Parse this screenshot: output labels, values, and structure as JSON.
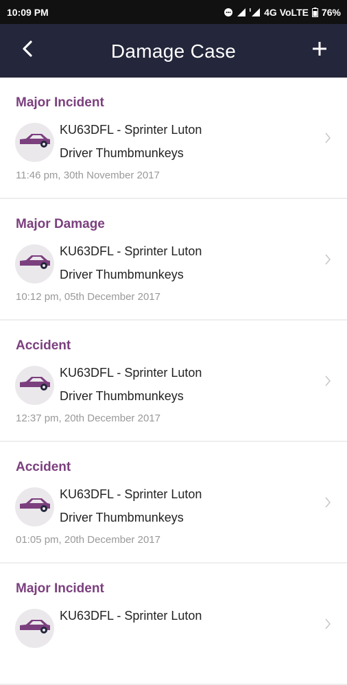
{
  "status_bar": {
    "time": "10:09 PM",
    "network": "4G VoLTE",
    "battery": "76%",
    "icons": [
      "chat-bubble-icon",
      "signal-icon",
      "signal-icon",
      "battery-icon"
    ]
  },
  "header": {
    "title": "Damage Case",
    "back_icon": "back-chevron-icon",
    "add_icon": "plus-icon",
    "background": "#24263b"
  },
  "colors": {
    "accent": "#7b3f7e",
    "car_icon": "#7b3f7e",
    "avatar_bg": "#ebe8ec",
    "timestamp": "#999999"
  },
  "cases": [
    {
      "type": "Major Incident",
      "vehicle": "KU63DFL - Sprinter Luton",
      "driver": "Driver Thumbmunkeys",
      "timestamp": "11:46 pm, 30th November 2017",
      "icon": "car-icon"
    },
    {
      "type": "Major Damage",
      "vehicle": "KU63DFL - Sprinter Luton",
      "driver": "Driver Thumbmunkeys",
      "timestamp": "10:12 pm, 05th December 2017",
      "icon": "car-icon"
    },
    {
      "type": "Accident",
      "vehicle": "KU63DFL - Sprinter Luton",
      "driver": "Driver Thumbmunkeys",
      "timestamp": "12:37 pm, 20th December 2017",
      "icon": "car-icon"
    },
    {
      "type": "Accident",
      "vehicle": "KU63DFL - Sprinter Luton",
      "driver": "Driver Thumbmunkeys",
      "timestamp": "01:05 pm, 20th December 2017",
      "icon": "car-icon"
    },
    {
      "type": "Major Incident",
      "vehicle": "KU63DFL - Sprinter Luton",
      "driver": "",
      "timestamp": "",
      "icon": "car-icon"
    }
  ]
}
